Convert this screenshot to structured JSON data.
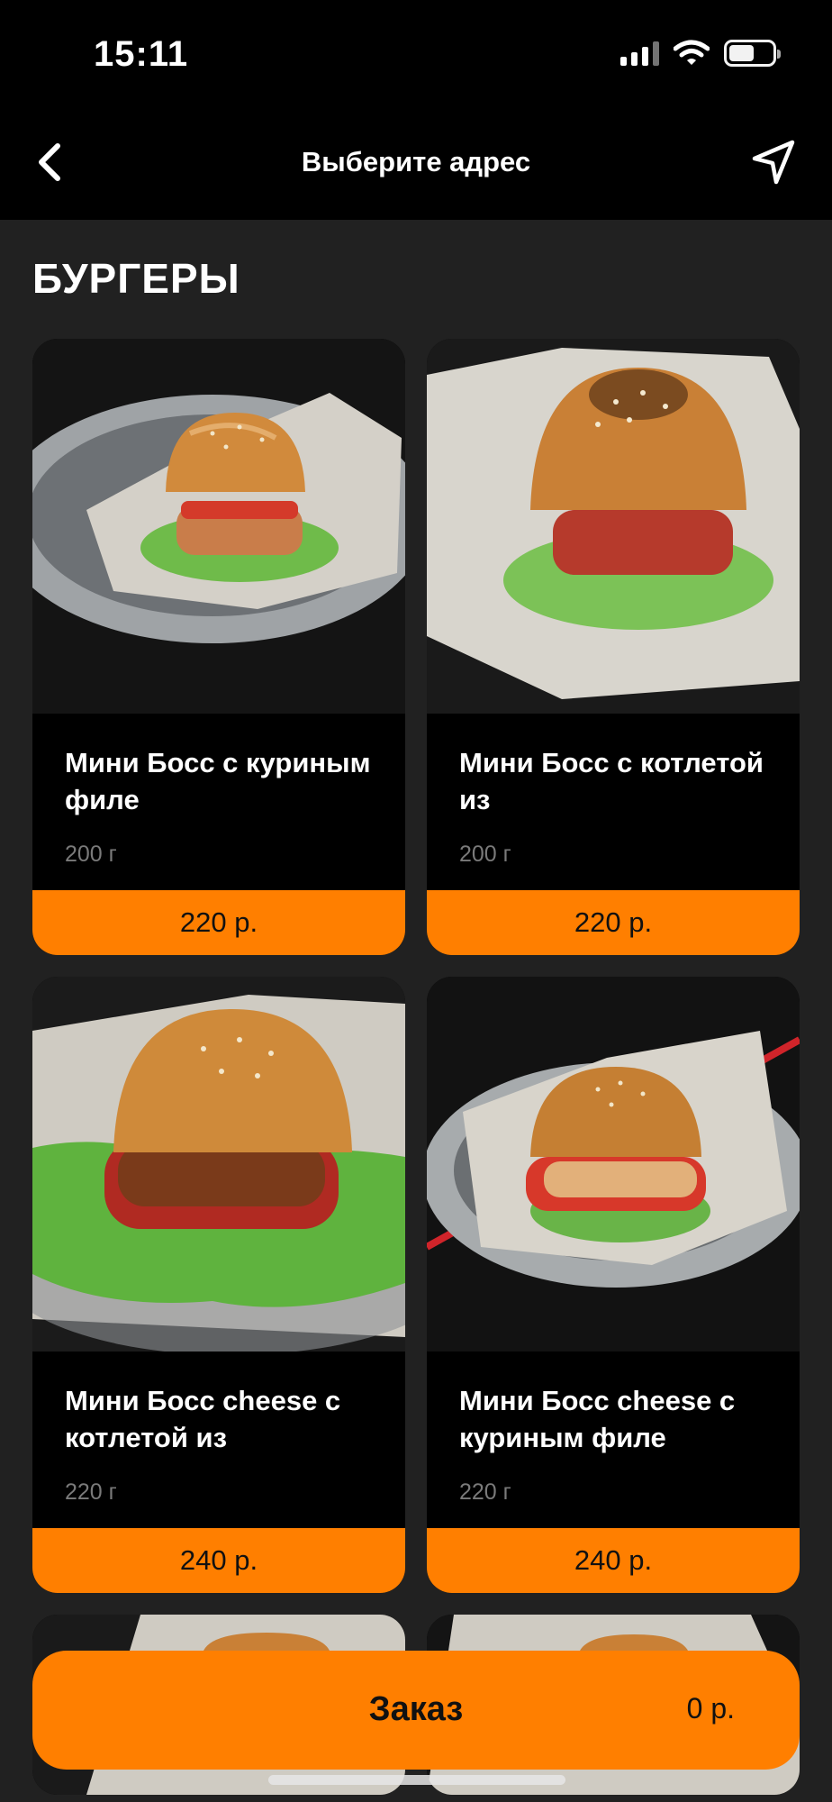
{
  "status": {
    "time": "15:11"
  },
  "nav": {
    "title": "Выберите адрес"
  },
  "section": {
    "title": "БУРГЕРЫ"
  },
  "products": [
    {
      "name": "Мини Босс с куриным филе",
      "weight": "200 г",
      "price": "220 р."
    },
    {
      "name": "Мини Босс с котлетой из",
      "weight": "200 г",
      "price": "220 р."
    },
    {
      "name": "Мини Босс cheese с котлетой из",
      "weight": "220 г",
      "price": "240 р."
    },
    {
      "name": "Мини Босс cheese с куриным филе",
      "weight": "220 г",
      "price": "240 р."
    }
  ],
  "order": {
    "label": "Заказ",
    "total": "0 р."
  },
  "colors": {
    "accent": "#ff7f00",
    "background": "#212121",
    "bars": "#000000"
  },
  "icons": [
    "cellular-signal-icon",
    "wifi-icon",
    "battery-icon",
    "back-arrow-icon",
    "location-arrow-icon"
  ]
}
